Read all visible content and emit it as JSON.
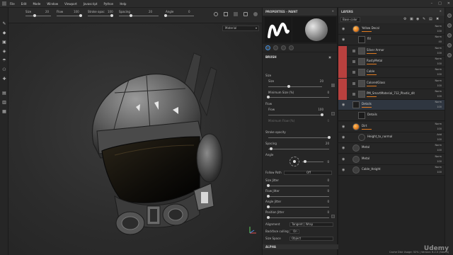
{
  "menu": {
    "items": [
      "File",
      "Edit",
      "Mode",
      "Window",
      "Viewport",
      "Javascript",
      "Python",
      "Help"
    ],
    "window_controls": [
      "–",
      "□",
      "✕"
    ]
  },
  "toolbar": {
    "size_label": "Size",
    "flow_label": "Flow",
    "stroke_label": "Stroke opac",
    "spacing_label": "Spacing",
    "angle_label": "Angle",
    "size_value": "20",
    "flow_value": "100",
    "stroke_value": "100",
    "spacing_value": "20",
    "angle_value": "0",
    "size_level": 0.35,
    "flow_level": 1.0,
    "stroke_level": 1.0,
    "spacing_level": 0.3,
    "angle_level": 0.0
  },
  "viewport": {
    "material_mode": "Material"
  },
  "properties": {
    "title": "PROPERTIES - PAINT",
    "brush_section": "BRUSH",
    "alpha_section": "ALPHA",
    "rows": [
      {
        "label": "Size",
        "value": "",
        "level": null
      },
      {
        "label": "Size",
        "value": "20",
        "level": 0.38
      },
      {
        "label": "Minimum Size (%)",
        "value": "0",
        "level": 0.0
      },
      {
        "label": "Flow",
        "value": "",
        "level": null
      },
      {
        "label": "Flow",
        "value": "100",
        "level": 1.0
      },
      {
        "label": "Minimum Flow (%)",
        "value": "0",
        "level": 0.0
      },
      {
        "label": "Stroke opacity",
        "value": "",
        "level": 1.0
      },
      {
        "label": "Spacing",
        "value": "20",
        "level": 0.05
      },
      {
        "label": "Angle",
        "value": "0",
        "level": null
      },
      {
        "label": "Follow Path",
        "value": "Off",
        "level": null
      },
      {
        "label": "Size Jitter",
        "value": "0",
        "level": 0.0
      },
      {
        "label": "Flow Jitter",
        "value": "0",
        "level": 0.0
      },
      {
        "label": "Angle Jitter",
        "value": "0",
        "level": 0.0
      },
      {
        "label": "Position Jitter",
        "value": "0",
        "level": 0.0
      },
      {
        "label": "Alignment",
        "value": "Tangent | Wrap",
        "level": null
      },
      {
        "label": "Backface culling",
        "value": "On",
        "level": null
      },
      {
        "label": "Size Space",
        "value": "Object",
        "level": null
      }
    ]
  },
  "layers": {
    "title": "LAYERS",
    "blend_mode": "Base color",
    "items": [
      {
        "name": "Yellow Decal",
        "mode": "Norm",
        "opac": "100",
        "type": "fill-orange",
        "indent": 0,
        "red": false,
        "eye": true
      },
      {
        "name": "fill",
        "mode": "Norm",
        "opac": "40",
        "type": "mask",
        "indent": 1,
        "red": false,
        "eye": true
      },
      {
        "name": "Silver Armor",
        "mode": "Norm",
        "opac": "100",
        "type": "folder",
        "indent": 0,
        "red": true,
        "eye": false
      },
      {
        "name": "RustyMetal",
        "mode": "Norm",
        "opac": "100",
        "type": "folder",
        "indent": 0,
        "red": true,
        "eye": false
      },
      {
        "name": "Cable",
        "mode": "Norm",
        "opac": "100",
        "type": "folder",
        "indent": 0,
        "red": true,
        "eye": false
      },
      {
        "name": "ColoredGlass",
        "mode": "Norm",
        "opac": "100",
        "type": "folder",
        "indent": 0,
        "red": true,
        "eye": false
      },
      {
        "name": "PM_SmartMaterial_712_Plastic_dit",
        "mode": "Norm",
        "opac": "100",
        "type": "folder",
        "indent": 0,
        "red": true,
        "eye": false
      },
      {
        "name": "Details",
        "mode": "Norm",
        "opac": "100",
        "type": "paint",
        "indent": 0,
        "red": false,
        "eye": true,
        "selected": true
      },
      {
        "name": "Details",
        "mode": "",
        "opac": "",
        "type": "mask",
        "indent": 1,
        "red": false,
        "eye": false
      },
      {
        "name": "Dirt",
        "mode": "Norm",
        "opac": "100",
        "type": "fill-orange",
        "indent": 0,
        "red": false,
        "eye": true
      },
      {
        "name": "Height_to_normal",
        "mode": "Add",
        "opac": "100",
        "type": "filter",
        "indent": 1,
        "red": false,
        "eye": true
      },
      {
        "name": "Metal",
        "mode": "Norm",
        "opac": "100",
        "type": "fill",
        "indent": 0,
        "red": false,
        "eye": true
      },
      {
        "name": "Metal",
        "mode": "Norm",
        "opac": "100",
        "type": "fill",
        "indent": 0,
        "red": false,
        "eye": true
      },
      {
        "name": "Cable_Height",
        "mode": "Norm",
        "opac": "100",
        "type": "fill",
        "indent": 0,
        "red": false,
        "eye": true
      }
    ]
  },
  "status": "Cache Disk Usage: 52% | Version: 6.2.0 (Steam)",
  "watermark": "Udemy",
  "colors": {
    "accent_orange": "#e07a1f",
    "layer_red": "#b8403e",
    "selection_blue": "#3d8ee0"
  }
}
